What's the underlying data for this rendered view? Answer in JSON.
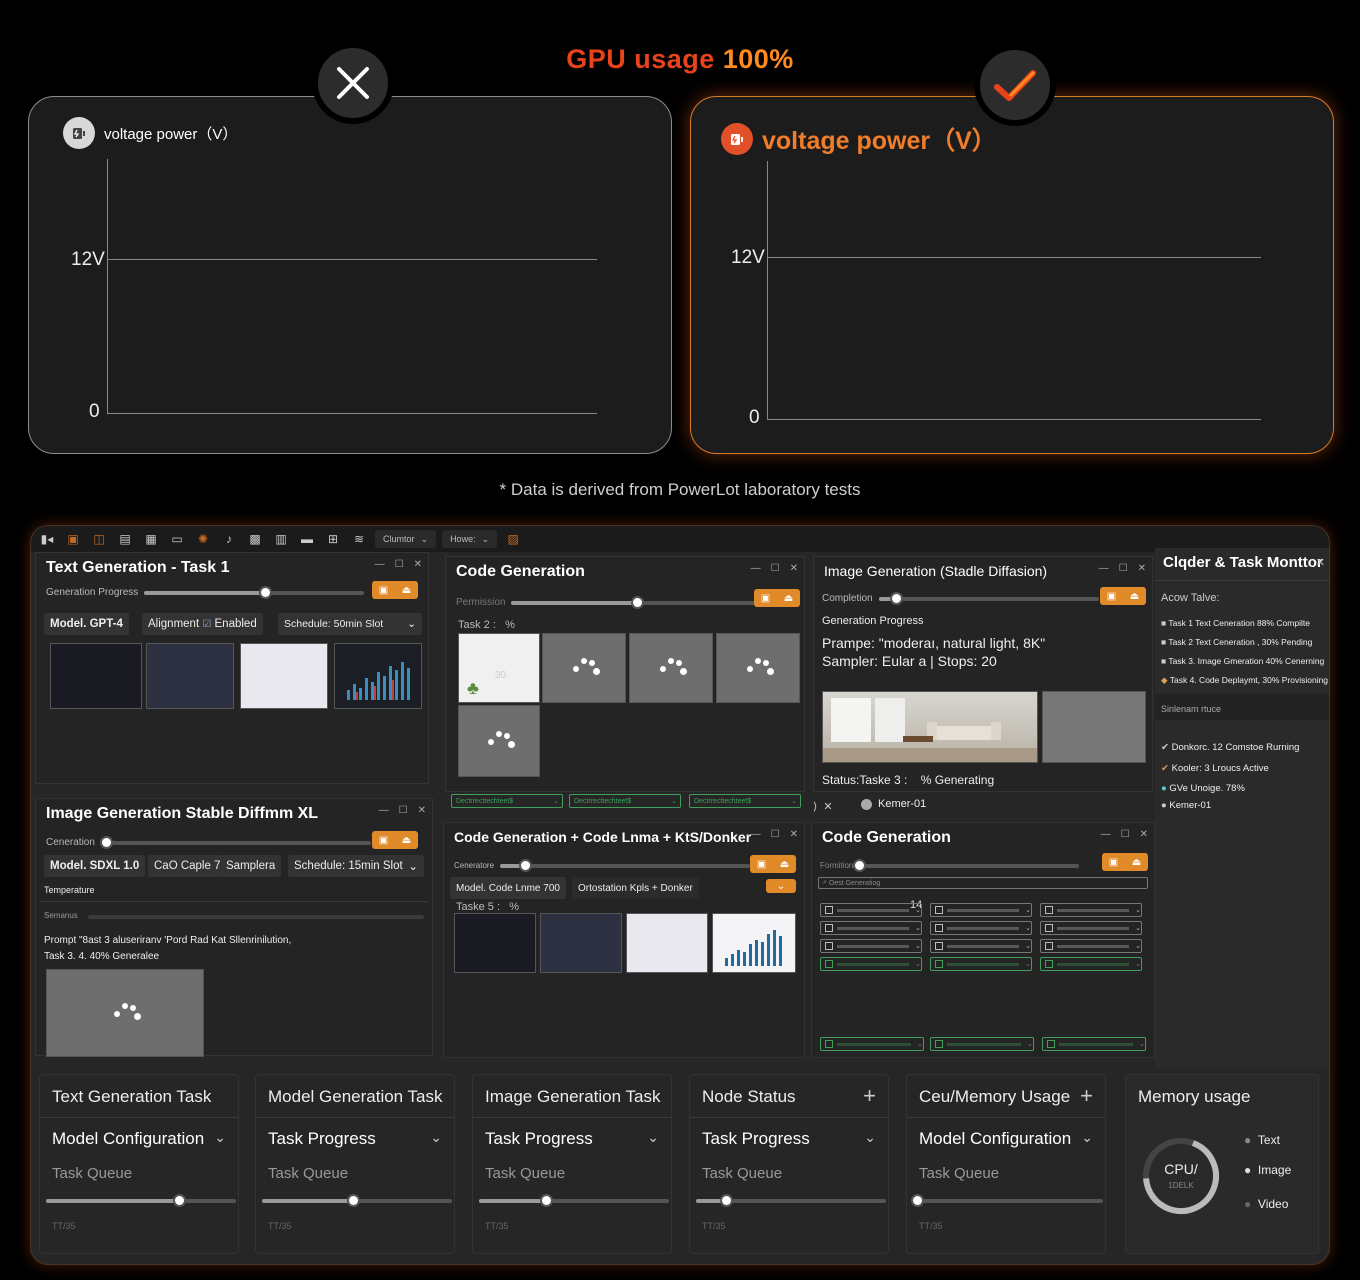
{
  "header": {
    "title_prefix": "GPU usage ",
    "title_value": "100%"
  },
  "left_card": {
    "label": "voltage power（V）",
    "tick_top": "12V",
    "tick_zero": "0",
    "status_icon": "x-icon"
  },
  "right_card": {
    "label": "voltage power（V）",
    "tick_top": "12V",
    "tick_zero": "0",
    "status_icon": "check-icon"
  },
  "footnote": "* Data is derived from PowerLot laboratory tests",
  "toolbar": {
    "dropdown1": "Clumtor",
    "dropdown2": "Howe:"
  },
  "win_text1": {
    "title": "Text Generation - Task 1",
    "slider_label": "Generation Progress",
    "slider_value": 0.55,
    "chips": [
      "Model. GPT-4",
      "Alignment",
      "Enabled",
      "Schedule: 50min Slot"
    ]
  },
  "win_code1": {
    "title": "Code Generation",
    "slider_label": "Permission",
    "slider_value": 0.45,
    "task": "Task 2 :",
    "task_pct": "%",
    "thumb_text": "30",
    "selects": [
      "Dectrrecttechteet$",
      "Dectrrecttechteet$",
      "Dectrrecttechteet$"
    ]
  },
  "win_img1": {
    "title": "Image Generation (Stadle Diffasion)",
    "slider_label": "Completion",
    "slider_value": 0.08,
    "section": "Generation Progress",
    "prompt": "Prampe: \"moderaı, natural light, 8K\"",
    "sampler": "Sampler: Eular a | Stops: 20",
    "status_left": "Status:Taske 3 :",
    "status_right": "% Generating",
    "node": "Kemer-01"
  },
  "monitor": {
    "title": "Clqder & Task Monttor",
    "active_label": "Acow Talve:",
    "tasks": [
      "Task 1 Text Ceneration  88% Compilte",
      "Task 2 Text Ceneration , 30% Pending",
      "Task 3. Image Gmeration  40% Cenerning",
      "Task 4. Code Deplaymt, 30% Provisioning"
    ],
    "section2": "Sinlenam rtuce",
    "nodes": [
      "Donkorc. 12 Comstoe Rurning",
      "Kooler: 3 Lroucs Active",
      "GVe Unoige. 78%",
      "Kemer-01"
    ]
  },
  "win_img2": {
    "title": "Image Generation  Stable Diffmm XL",
    "slider_label": "Ceneration",
    "slider_value": 0.02,
    "chips": [
      "Model. SDXL 1.0",
      "CaO Caple 7",
      "Samplera",
      "Schedule: 15min Slot"
    ],
    "temperature": "Temperature",
    "seed": "Semanus",
    "prompt": "Prompt \"8ast 3 aluseriranv 'Pord Rad Kat Sllenrinilution,",
    "task": "Task 3. 4. 40% Generalee"
  },
  "win_code2": {
    "title": "Code Generation + Code Lnma + KtS/Donker",
    "slider_label": "Ceneratore",
    "slider_value": 0.1,
    "chip1": "Model. Code Lnme 700",
    "chip2": "Ortostation Kpls + Donker",
    "task": "Taske 5 :",
    "task_pct": "%"
  },
  "win_code3": {
    "title": "Code Generation",
    "slider_label": "Formition",
    "slider_value": 0.0,
    "search": "Oest Generatiog",
    "badge": "14"
  },
  "bottom_cards": [
    {
      "title": "Text Generation Task",
      "sub": "Model Configuration",
      "queue": "Task Queue",
      "foot": "TT/35",
      "progress": 0.7
    },
    {
      "title": "Model Generation Task",
      "sub": "Task Progress",
      "queue": "Task Queue",
      "foot": "TT/35",
      "progress": 0.48
    },
    {
      "title": "Image Generation Task",
      "sub": "Task Progress",
      "queue": "Task Queue",
      "foot": "TT/35",
      "progress": 0.35
    },
    {
      "title": "Node Status",
      "sub": "Task Progress",
      "queue": "Task Queue",
      "foot": "TT/35",
      "progress": 0.16
    },
    {
      "title": "Ceu/Memory Usage",
      "sub": "Model Configuration",
      "queue": "Task Queue",
      "foot": "TT/35",
      "progress": 0.02
    }
  ],
  "memory": {
    "title": "Memory usage",
    "center": "CPU/",
    "center_sub": "1DELK",
    "legend": [
      "Text",
      "Image",
      "Video"
    ]
  }
}
